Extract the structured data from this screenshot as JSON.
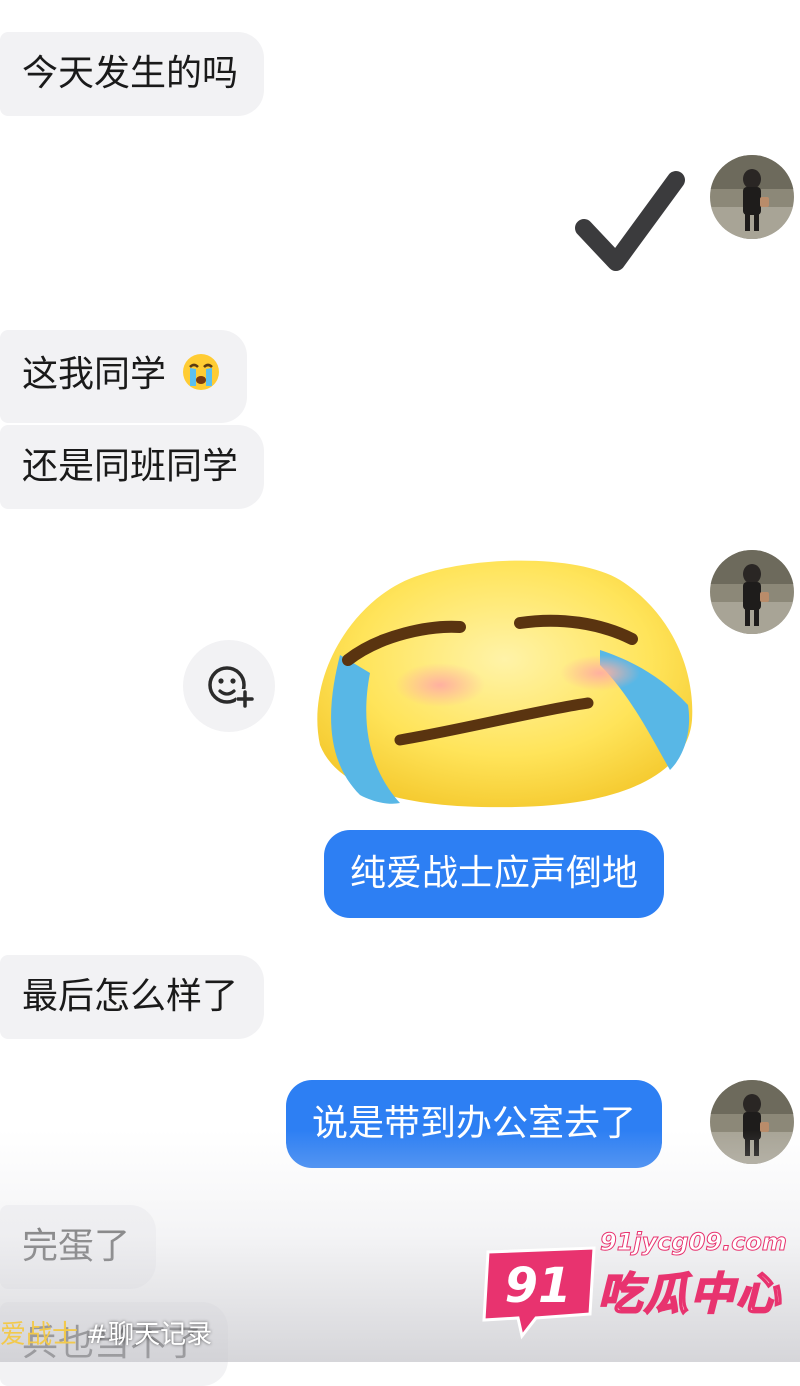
{
  "messages": {
    "m1": "今天发生的吗",
    "m3": "这我同学",
    "m4": "还是同班同学",
    "m6": "纯爱战士应声倒地",
    "m7": "最后怎么样了",
    "m8": "说是带到办公室去了",
    "m9": "完蛋了",
    "m10": "兵也当不了"
  },
  "icons": {
    "reply_check": "check-mark-icon",
    "crying_emoji": "loudly-crying-face-icon",
    "add_reaction": "add-emoji-reaction-icon",
    "sticker": "crying-face-sticker",
    "avatar": "user-avatar-photo"
  },
  "caption": {
    "user": "爱战士",
    "tag": "#聊天记录"
  },
  "watermark": {
    "badge": "91",
    "url": "91jycg09.com",
    "name": "吃瓜中心"
  },
  "colors": {
    "incoming_bubble": "#f2f2f4",
    "outgoing_bubble": "#2d7ff3",
    "watermark_pink": "#e8336f"
  }
}
